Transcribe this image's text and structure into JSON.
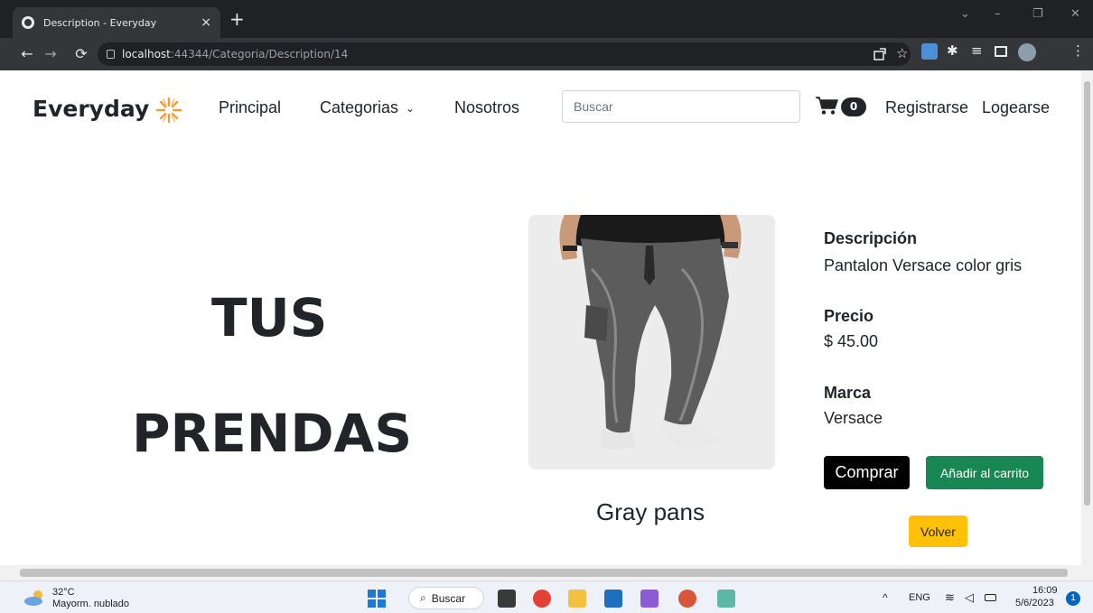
{
  "browser": {
    "tab_title": "Description - Everyday",
    "tab_close": "×",
    "new_tab": "+",
    "url_host": "localhost",
    "url_path": ":44344/Categoria/Description/14",
    "window_min": "–",
    "window_restore": "❐",
    "window_close": "✕",
    "tab_search": "⌄"
  },
  "navbar": {
    "brand": "Everyday",
    "links": [
      "Principal",
      "Categorias",
      "Nosotros"
    ],
    "search_placeholder": "Buscar",
    "cart_count": "0",
    "register": "Registrarse",
    "login": "Logearse"
  },
  "hero": {
    "line1": "TUS",
    "line2": "PRENDAS"
  },
  "product": {
    "name": "Gray pans",
    "description_label": "Descripción",
    "description": "Pantalon Versace color gris",
    "price_label": "Precio",
    "price": "$ 45.00",
    "brand_label": "Marca",
    "brand": "Versace",
    "buy_label": "Comprar",
    "add_to_cart_label": "Añadir al carrito",
    "back_label": "Volver"
  },
  "taskbar": {
    "temperature": "32°C",
    "weather": "Mayorm. nublado",
    "search_label": "Buscar",
    "language": "ENG",
    "time": "16:09",
    "date": "5/6/2023",
    "notifications": "1"
  },
  "colors": {
    "buy": "#000000",
    "add_to_cart": "#198754",
    "back": "#ffc107",
    "brand_sun": "#f39c3a"
  }
}
